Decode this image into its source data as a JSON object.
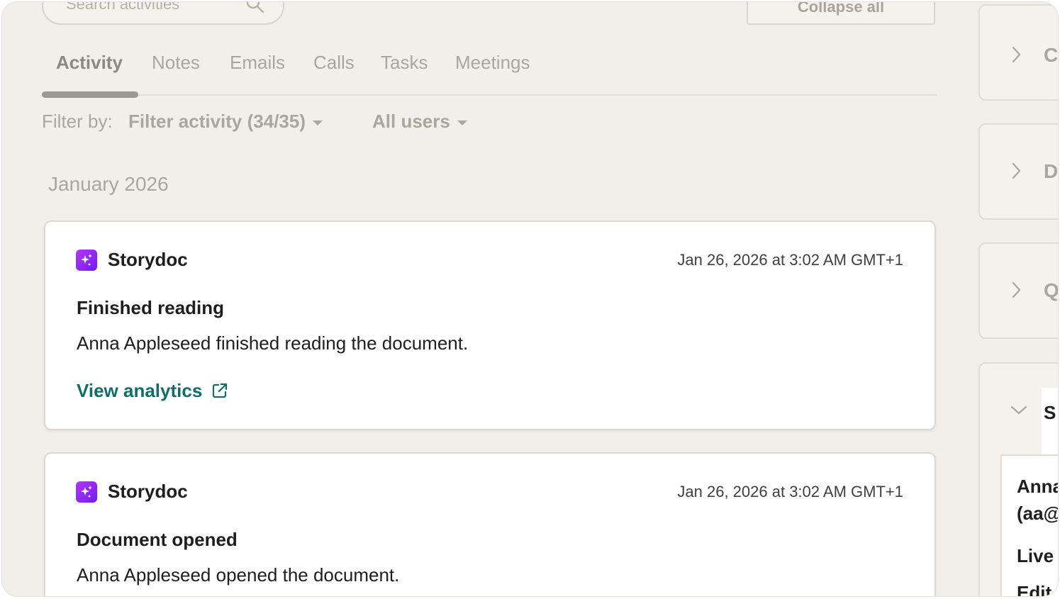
{
  "search": {
    "placeholder": "Search activities"
  },
  "toolbar": {
    "collapse_label": "Collapse all"
  },
  "tabs": [
    {
      "label": "Activity",
      "active": true
    },
    {
      "label": "Notes"
    },
    {
      "label": "Emails"
    },
    {
      "label": "Calls"
    },
    {
      "label": "Tasks"
    },
    {
      "label": "Meetings"
    }
  ],
  "filters": {
    "label": "Filter by:",
    "activity": "Filter activity (34/35)",
    "users": "All users"
  },
  "month_heading": "January 2026",
  "activities": [
    {
      "app": "Storydoc",
      "timestamp": "Jan 26, 2026 at 3:02 AM GMT+1",
      "title": "Finished reading",
      "description": "Anna Appleseed finished reading the document.",
      "link": "View analytics"
    },
    {
      "app": "Storydoc",
      "timestamp": "Jan 26, 2026 at 3:02 AM GMT+1",
      "title": "Document opened",
      "description": "Anna Appleseed opened the document."
    }
  ],
  "sidebar": {
    "sections": [
      {
        "label": "C",
        "icon": "chevron-right-icon"
      },
      {
        "label": "D",
        "icon": "chevron-right-icon"
      },
      {
        "label": "Q",
        "icon": "chevron-right-icon"
      },
      {
        "label": "S",
        "icon": "chevron-down-icon"
      }
    ],
    "detail_lines": [
      "Anna",
      "(aa@",
      "Live",
      "Edit"
    ]
  },
  "colors": {
    "background": "#f2efeb",
    "link": "#0f6e6a",
    "app_icon": "#8a2be2",
    "muted_text": "#aca59e"
  }
}
